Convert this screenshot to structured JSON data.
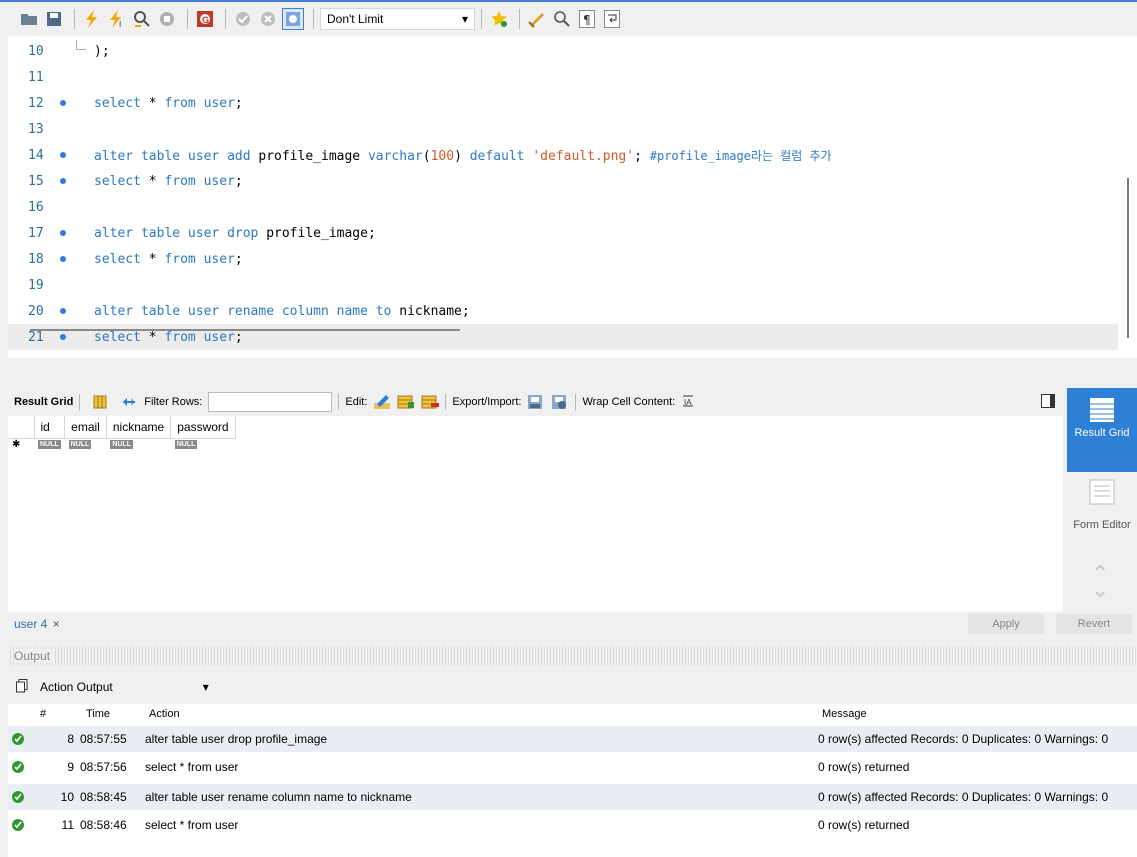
{
  "toolbar": {
    "limit_value": "Don't Limit",
    "icons": [
      "folder-icon",
      "save-icon",
      "execute-icon",
      "execute-current-icon",
      "explain-icon",
      "stop-icon",
      "toggle-error-icon",
      "commit-icon",
      "rollback-icon",
      "autocommit-icon",
      "beautify-icon",
      "find-icon",
      "invisible-chars-icon",
      "wrap-icon",
      "bookmark-icon"
    ]
  },
  "editor": {
    "lines": [
      {
        "n": "10",
        "t": ");"
      },
      {
        "n": "11",
        "t": ""
      },
      {
        "n": "12",
        "t": "select * from user;"
      },
      {
        "n": "13",
        "t": ""
      },
      {
        "n": "14",
        "t": "alter table user add profile_image varchar(100) default 'default.png'; #profile_image라는 컬럼 추가"
      },
      {
        "n": "15",
        "t": "select * from user;"
      },
      {
        "n": "16",
        "t": ""
      },
      {
        "n": "17",
        "t": "alter table user drop profile_image;"
      },
      {
        "n": "18",
        "t": "select * from user;"
      },
      {
        "n": "19",
        "t": ""
      },
      {
        "n": "20",
        "t": "alter table user rename column name to nickname;"
      },
      {
        "n": "21",
        "t": "select * from user;"
      }
    ]
  },
  "result": {
    "result_grid_label": "Result Grid",
    "filter_label": "Filter Rows:",
    "edit_label": "Edit:",
    "export_label": "Export/Import:",
    "wrap_label": "Wrap Cell Content:",
    "columns": [
      "id",
      "email",
      "nickname",
      "password"
    ],
    "null_label": "NULL",
    "side_result": "Result Grid",
    "side_form": "Form Editor",
    "tab_label": "user 4",
    "apply": "Apply",
    "revert": "Revert"
  },
  "output": {
    "header": "Output",
    "selector": "Action Output",
    "columns": {
      "num": "#",
      "time": "Time",
      "action": "Action",
      "message": "Message"
    },
    "rows": [
      {
        "num": "8",
        "time": "08:57:55",
        "action": "alter table user drop profile_image",
        "message": "0 row(s) affected Records: 0  Duplicates: 0  Warnings: 0"
      },
      {
        "num": "9",
        "time": "08:57:56",
        "action": "select * from user",
        "message": "0 row(s) returned"
      },
      {
        "num": "10",
        "time": "08:58:45",
        "action": "alter table user rename column name to nickname",
        "message": "0 row(s) affected Records: 0  Duplicates: 0  Warnings: 0"
      },
      {
        "num": "11",
        "time": "08:58:46",
        "action": "select * from user",
        "message": "0 row(s) returned"
      }
    ]
  },
  "colors": {
    "accent": "#2e7fd6",
    "keyword": "#2c79c4",
    "string": "#d25a2a",
    "ok": "#2e9a2e"
  }
}
